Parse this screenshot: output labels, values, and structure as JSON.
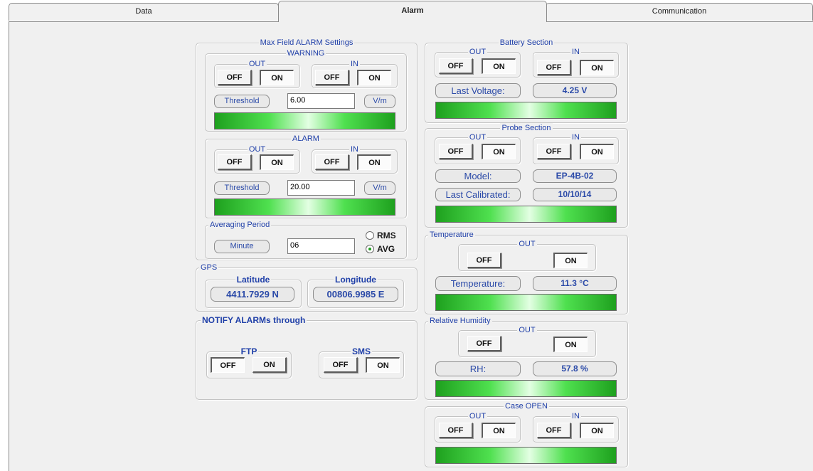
{
  "tabs": [
    "Data",
    "Alarm",
    "Communication"
  ],
  "toggle": {
    "off": "OFF",
    "on": "ON"
  },
  "labels": {
    "out": "OUT",
    "in": "IN"
  },
  "max_field": {
    "title": "Max Field ALARM Settings",
    "warning": {
      "title": "WARNING",
      "out_state": "ON",
      "in_state": "ON",
      "threshold_label": "Threshold",
      "threshold_value": "6.00",
      "unit": "V/m"
    },
    "alarm": {
      "title": "ALARM",
      "out_state": "ON",
      "in_state": "ON",
      "threshold_label": "Threshold",
      "threshold_value": "20.00",
      "unit": "V/m"
    },
    "averaging": {
      "title": "Averaging Period",
      "label": "Minute",
      "value": "06",
      "options": [
        "RMS",
        "AVG"
      ],
      "selected": "AVG"
    }
  },
  "gps": {
    "title": "GPS",
    "latitude_label": "Latitude",
    "latitude": "4411.7929 N",
    "longitude_label": "Longitude",
    "longitude": "00806.9985 E"
  },
  "notify": {
    "title": "NOTIFY ALARMs through",
    "ftp": {
      "label": "FTP",
      "state": "OFF"
    },
    "sms": {
      "label": "SMS",
      "state": "ON"
    }
  },
  "battery": {
    "title": "Battery Section",
    "out_state": "ON",
    "in_state": "ON",
    "label": "Last Voltage:",
    "value": "4.25 V"
  },
  "probe": {
    "title": "Probe Section",
    "out_state": "ON",
    "in_state": "ON",
    "model_label": "Model:",
    "model": "EP-4B-02",
    "calibrated_label": "Last Calibrated:",
    "calibrated": "10/10/14"
  },
  "temperature": {
    "title": "Temperature",
    "out_state": "ON",
    "label": "Temperature:",
    "value": "11.3 °C"
  },
  "humidity": {
    "title": "Relative Humidity",
    "out_state": "ON",
    "label": "RH:",
    "value": "57.8 %"
  },
  "case_open": {
    "title": "Case OPEN",
    "out_state": "ON",
    "in_state": "ON"
  },
  "colors": {
    "label_text": "#2b4aa8",
    "bar_green": "#1ea01e",
    "bar_highlight": "#e3ffe3",
    "panel_bg": "#f0f0f0"
  }
}
